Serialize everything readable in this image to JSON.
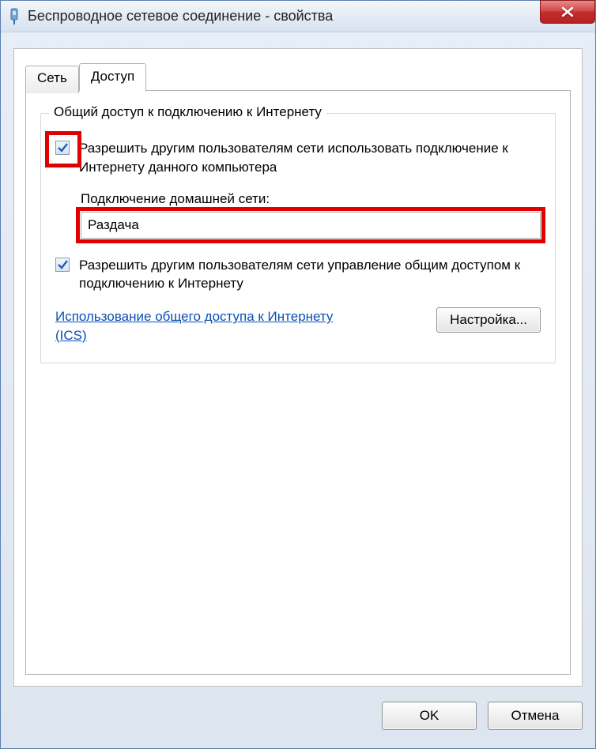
{
  "window": {
    "title": "Беспроводное сетевое соединение - свойства"
  },
  "tabs": {
    "network": "Сеть",
    "access": "Доступ"
  },
  "group": {
    "legend": "Общий доступ к подключению к Интернету",
    "allow_others_label": "Разрешить другим пользователям сети использовать подключение к Интернету данного компьютера",
    "home_connection_label": "Подключение домашней сети:",
    "home_connection_value": "Раздача",
    "allow_control_label": "Разрешить другим пользователям сети управление общим доступом к подключению к Интернету",
    "link_text": "Использование общего доступа к Интернету (ICS)",
    "settings_button": "Настройка..."
  },
  "footer": {
    "ok": "OK",
    "cancel": "Отмена"
  }
}
